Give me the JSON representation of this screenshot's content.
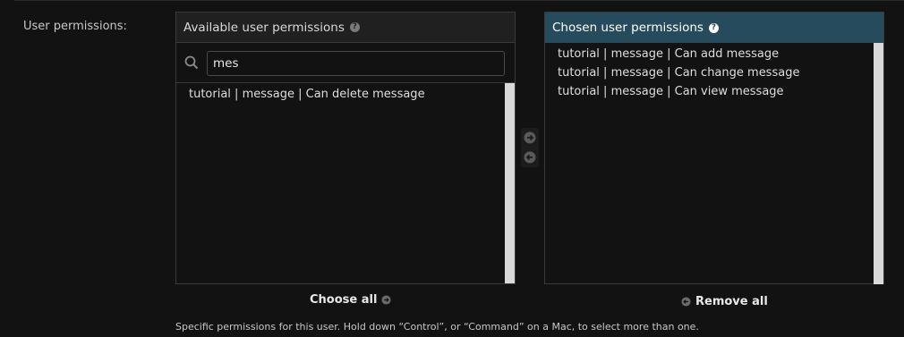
{
  "field": {
    "label": "User permissions:"
  },
  "available": {
    "title": "Available user permissions",
    "help_icon": "question-circle-icon",
    "filter": {
      "value": "mes",
      "icon": "search-icon"
    },
    "items": [
      "tutorial | message | Can delete message"
    ],
    "choose_all_label": "Choose all"
  },
  "chosen": {
    "title": "Chosen user permissions",
    "help_icon": "question-circle-icon",
    "items": [
      "tutorial | message | Can add message",
      "tutorial | message | Can change message",
      "tutorial | message | Can view message"
    ],
    "remove_all_label": "Remove all"
  },
  "help_text": "Specific permissions for this user. Hold down “Control”, or “Command” on a Mac, to select more than one.",
  "colors": {
    "background": "#121212",
    "chosen_header": "#264b5d",
    "border": "#3a3a3a",
    "scrollbar": "#d9d9d9"
  }
}
